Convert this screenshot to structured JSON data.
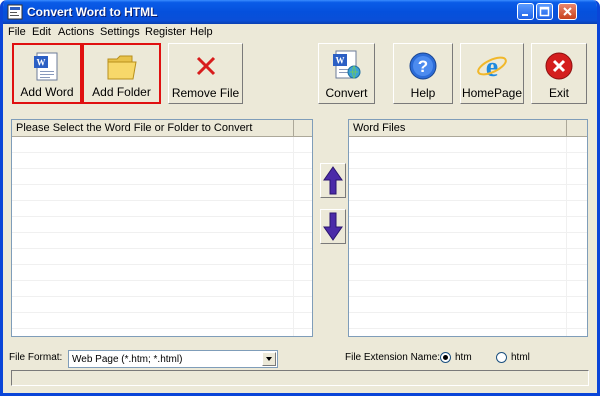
{
  "title": "Convert Word to HTML",
  "menu": [
    "File",
    "Edit",
    "Actions",
    "Settings",
    "Register",
    "Help"
  ],
  "toolbar": {
    "add_word": "Add Word",
    "add_folder": "Add Folder",
    "remove_file": "Remove File",
    "convert": "Convert",
    "help": "Help",
    "homepage": "HomePage",
    "exit": "Exit"
  },
  "icons": {
    "add_word": "word-document-icon",
    "add_folder": "folder-icon",
    "remove_file": "red-x-icon",
    "convert": "word-convert-icon",
    "help": "question-mark-icon",
    "homepage": "internet-explorer-icon",
    "exit": "exit-icon",
    "move_up": "arrow-up-icon",
    "move_down": "arrow-down-icon"
  },
  "left_panel": {
    "header": "Please Select the Word File or Folder to Convert"
  },
  "right_panel": {
    "header": "Word Files"
  },
  "file_format": {
    "label": "File Format:",
    "value": "Web Page (*.htm; *.html)"
  },
  "extension": {
    "label": "File Extension Name:",
    "options": [
      {
        "label": "htm",
        "selected": true
      },
      {
        "label": "html",
        "selected": false
      }
    ]
  },
  "colors": {
    "title_bar": "#0A5CE8",
    "highlight": "#E01010",
    "face": "#ECE9D8",
    "arrow": "#4B2BA8"
  }
}
